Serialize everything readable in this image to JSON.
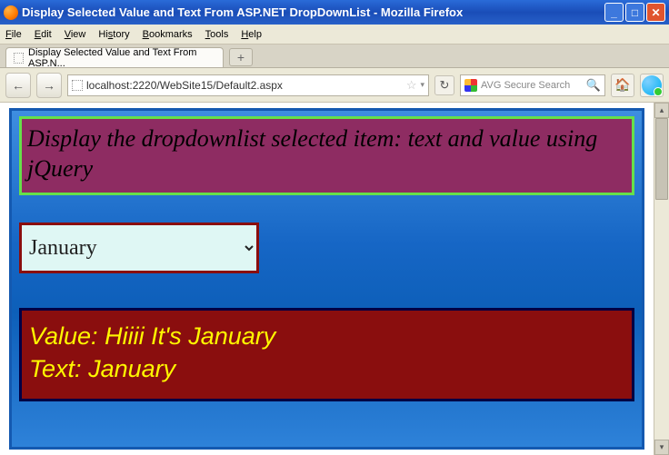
{
  "window": {
    "title": "Display Selected Value and Text From ASP.NET DropDownList - Mozilla Firefox",
    "min": "_",
    "max": "□",
    "close": "✕"
  },
  "menu": {
    "file": "File",
    "edit": "Edit",
    "view": "View",
    "history": "History",
    "bookmarks": "Bookmarks",
    "tools": "Tools",
    "help": "Help"
  },
  "tab": {
    "title": "Display Selected Value and Text From ASP.N...",
    "new": "+"
  },
  "nav": {
    "back": "←",
    "forward": "→",
    "url": "localhost:2220/WebSite15/Default2.aspx",
    "star": "☆",
    "drop": "▾",
    "reload": "↻",
    "search_placeholder": "AVG Secure Search",
    "mag": "🔍",
    "home": "🏠"
  },
  "page": {
    "heading": "Display the dropdownlist selected item: text and value using jQuery",
    "dropdown_selected": "January",
    "result_value_label": "Value:",
    "result_value": "Hiiii It's January",
    "result_text_label": "Text:",
    "result_text": "January"
  },
  "scroll": {
    "up": "▴",
    "down": "▾"
  }
}
